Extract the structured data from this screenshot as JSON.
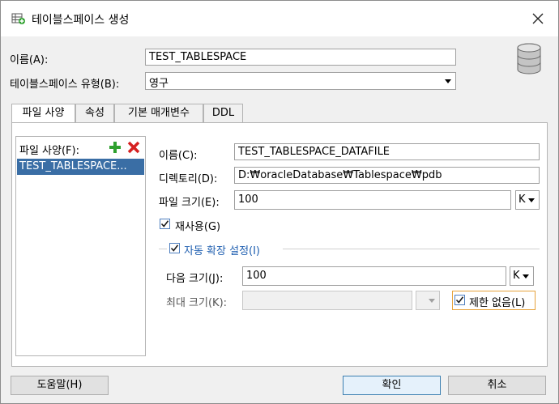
{
  "window": {
    "title": "테이블스페이스 생성",
    "close_label": "×"
  },
  "header": {
    "name_label": "이름(A):",
    "name_value": "TEST_TABLESPACE",
    "type_label": "테이블스페이스 유형(B):",
    "type_value": "영구"
  },
  "tabs": [
    {
      "label": "파일 사양"
    },
    {
      "label": "속성"
    },
    {
      "label": "기본 매개변수"
    },
    {
      "label": "DDL"
    }
  ],
  "file_list": {
    "label": "파일 사양(F):",
    "items": [
      "TEST_TABLESPACE..."
    ]
  },
  "file_spec": {
    "name_label": "이름(C):",
    "name_value": "TEST_TABLESPACE_DATAFILE",
    "dir_label": "디렉토리(D):",
    "dir_value": "D:₩oracleDatabase₩Tablespace₩pdb",
    "size_label": "파일 크기(E):",
    "size_value": "100",
    "size_unit": "K",
    "reuse_label": "재사용(G)",
    "autoextend_label": "자동 확장 설정(I)",
    "next_label": "다음 크기(J):",
    "next_value": "100",
    "next_unit": "K",
    "max_label": "최대 크기(K):",
    "unlimited_label": "제한 없음(L)"
  },
  "footer": {
    "help_label": "도움말(H)",
    "ok_label": "확인",
    "cancel_label": "취소"
  },
  "colors": {
    "selection": "#3a6ea5",
    "add_icon": "#2ea02e",
    "remove_icon": "#d62020",
    "link_text": "#1f5fb0"
  }
}
